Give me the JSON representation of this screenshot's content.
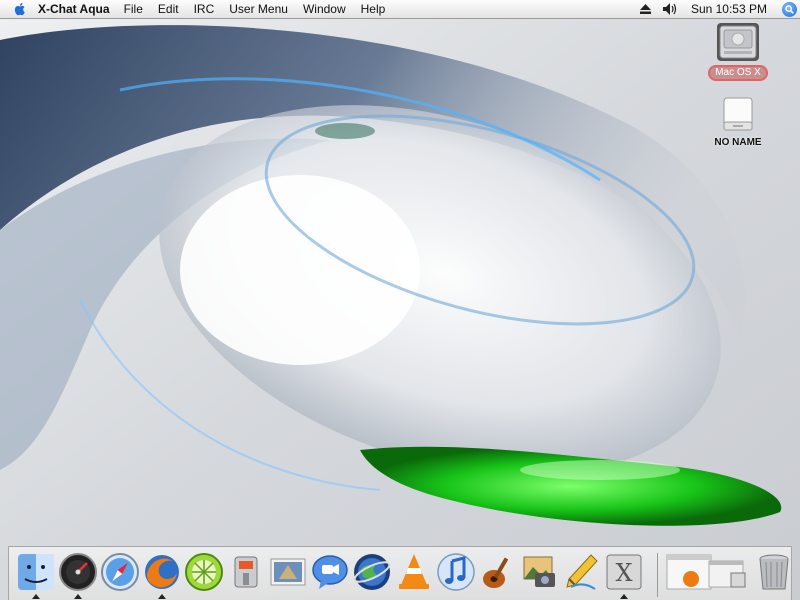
{
  "menubar": {
    "app_name": "X-Chat Aqua",
    "menus": [
      "File",
      "Edit",
      "IRC",
      "User Menu",
      "Window",
      "Help"
    ],
    "clock": "Sun 10:53 PM"
  },
  "desktop": {
    "icons": [
      {
        "label": "Mac OS X",
        "icon": "hard-drive-icon"
      },
      {
        "label": "NO NAME",
        "icon": "removable-volume-icon"
      }
    ]
  },
  "dock": {
    "apps": [
      {
        "name": "finder-icon",
        "running": true
      },
      {
        "name": "dashboard-icon",
        "running": true
      },
      {
        "name": "safari-icon",
        "running": false
      },
      {
        "name": "firefox-icon",
        "running": true
      },
      {
        "name": "limewire-icon",
        "running": false
      },
      {
        "name": "utility-tool-icon",
        "running": false
      },
      {
        "name": "mail-icon",
        "running": false
      },
      {
        "name": "ichat-icon",
        "running": false
      },
      {
        "name": "google-earth-icon",
        "running": false
      },
      {
        "name": "vlc-icon",
        "running": false
      },
      {
        "name": "itunes-icon",
        "running": false
      },
      {
        "name": "garageband-icon",
        "running": false
      },
      {
        "name": "iphoto-icon",
        "running": false
      },
      {
        "name": "pen-tool-icon",
        "running": false
      },
      {
        "name": "xchat-icon",
        "running": true
      },
      {
        "name": "minimized-window-icon",
        "running": false
      },
      {
        "name": "trash-icon",
        "running": false
      }
    ]
  },
  "colors": {
    "menubar": "#f0f0f0",
    "selection_red": "#e16464",
    "wallpaper_green": "#1fc81f",
    "wallpaper_blue": "#2a4a7a"
  }
}
